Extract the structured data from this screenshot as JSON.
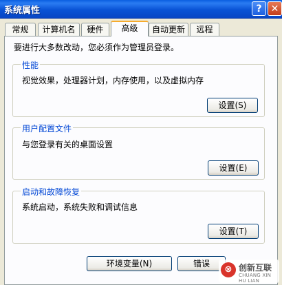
{
  "window": {
    "title": "系统属性",
    "help_glyph": "?",
    "close_glyph": "✕"
  },
  "tabs": [
    {
      "label": "常规",
      "active": false
    },
    {
      "label": "计算机名",
      "active": false
    },
    {
      "label": "硬件",
      "active": false
    },
    {
      "label": "高级",
      "active": true
    },
    {
      "label": "自动更新",
      "active": false
    },
    {
      "label": "远程",
      "active": false
    }
  ],
  "intro_text": "要进行大多数改动，您必须作为管理员登录。",
  "groups": {
    "performance": {
      "title": "性能",
      "description": "视觉效果，处理器计划，内存使用，以及虚拟内存",
      "button": "设置(S)"
    },
    "user_profiles": {
      "title": "用户配置文件",
      "description": "与您登录有关的桌面设置",
      "button": "设置(E)"
    },
    "startup_recovery": {
      "title": "启动和故障恢复",
      "description": "系统启动，系统失败和调试信息",
      "button": "设置(T)"
    }
  },
  "bottom_buttons": {
    "env_vars": "环境变量(N)",
    "error_report": "错误"
  },
  "watermark": {
    "logo_glyph": "⊗",
    "brand": "创新互联",
    "sub": "CHUANG XIN HU LIAN"
  },
  "colors": {
    "titlebar": "#0a5fe0",
    "active_tab_accent": "#f7ab2d",
    "group_title": "#0046d5",
    "dialog_bg": "#ece9d8"
  }
}
